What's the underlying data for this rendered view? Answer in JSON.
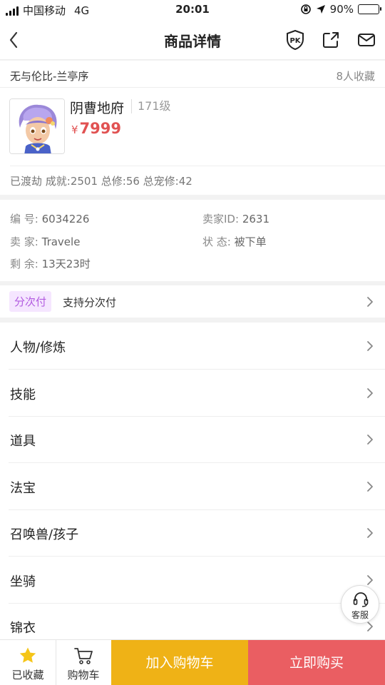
{
  "status_bar": {
    "carrier": "中国移动",
    "network": "4G",
    "time": "20:01",
    "battery": "90%",
    "battery_level": 0.9
  },
  "nav": {
    "title": "商品详情"
  },
  "server": {
    "name": "无与伦比-兰亭序",
    "favorites": "8人收藏"
  },
  "item": {
    "name": "阴曹地府",
    "level": "171级",
    "currency": "¥",
    "price": "7999",
    "stats": "已渡劫 成就:2501 总修:56 总宠修:42"
  },
  "info": {
    "id_label": "编 号:",
    "id_value": "6034226",
    "seller_id_label": "卖家ID:",
    "seller_id_value": "2631",
    "seller_label": "卖 家:",
    "seller_value": "Travele",
    "status_label": "状 态:",
    "status_value": "被下单",
    "remaining_label": "剩 余:",
    "remaining_value": "13天23时"
  },
  "installment": {
    "tag": "分次付",
    "text": "支持分次付"
  },
  "menu": {
    "items": [
      {
        "label": "人物/修炼"
      },
      {
        "label": "技能"
      },
      {
        "label": "道具"
      },
      {
        "label": "法宝"
      },
      {
        "label": "召唤兽/孩子"
      },
      {
        "label": "坐骑"
      },
      {
        "label": "锦衣"
      }
    ]
  },
  "float": {
    "service_label": "客服"
  },
  "bottom": {
    "favorited_label": "已收藏",
    "cart_label": "购物车",
    "add_to_cart": "加入购物车",
    "buy_now": "立即购买"
  },
  "colors": {
    "price": "#e15252",
    "add_to_cart_bg": "#efb216",
    "buy_now_bg": "#ea5e62",
    "installment_tag": "#b25be0",
    "star": "#f5c518"
  }
}
